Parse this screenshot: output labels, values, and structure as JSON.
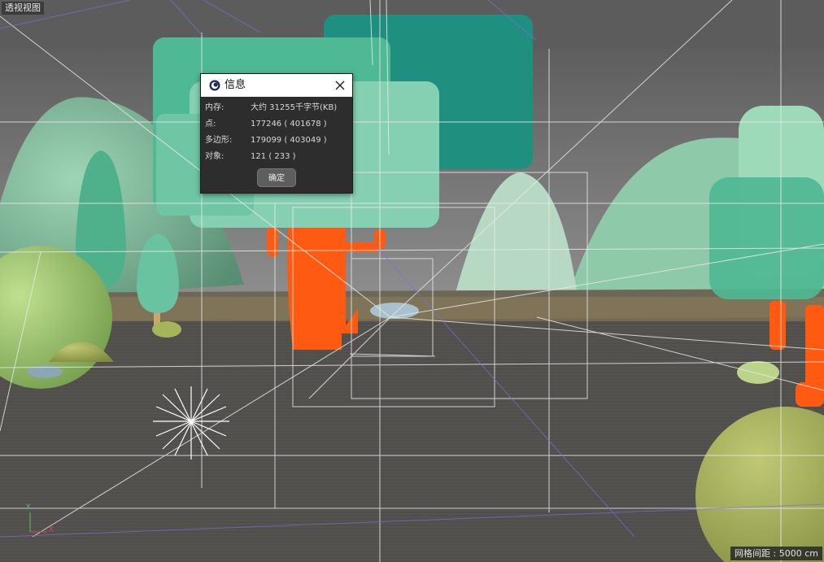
{
  "viewport": {
    "view_name": "透视视图",
    "grid_spacing": "网格间距 : 5000 cm",
    "axis_y": "Y",
    "axis_x": "X"
  },
  "dialog": {
    "title": "信息",
    "rows": [
      {
        "label": "内存:",
        "value": "大约 31255千字节(KB)"
      },
      {
        "label": "点:",
        "value": "177246 ( 401678 )"
      },
      {
        "label": "多边形:",
        "value": "179099 ( 403049 )"
      },
      {
        "label": "对象:",
        "value": "121 ( 233 )"
      }
    ],
    "ok_label": "确定"
  },
  "colors": {
    "teal_dark": "#1f8f80",
    "teal_mid": "#4fb894",
    "mint_light": "#85d0b2",
    "orange": "#ff5a12",
    "olive": "#a7b55a",
    "hill_green": "#8fc09a",
    "ground": "#575450"
  }
}
